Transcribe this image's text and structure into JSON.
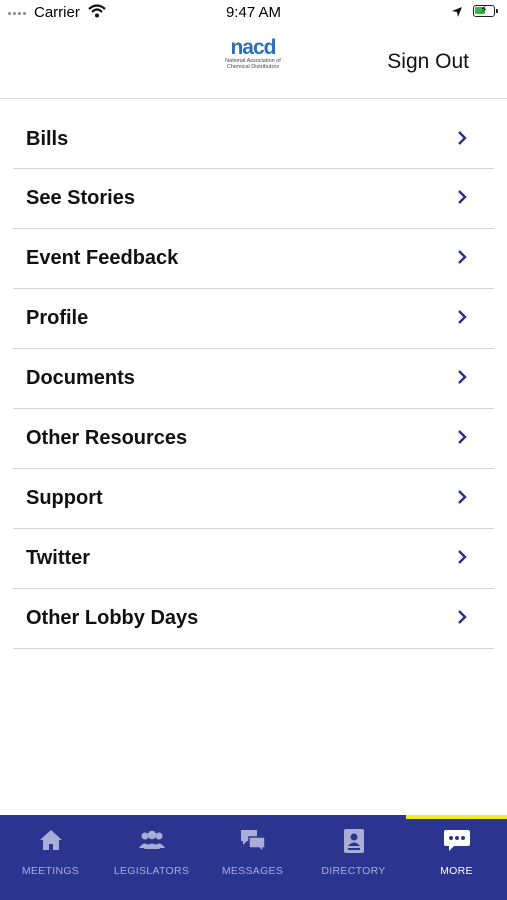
{
  "status": {
    "carrier": "Carrier",
    "time": "9:47 AM"
  },
  "header": {
    "logo_text": "nacd",
    "logo_subtitle": "National Association of Chemical Distributors",
    "sign_out": "Sign Out"
  },
  "menu": {
    "items": [
      {
        "label": "Bills"
      },
      {
        "label": "See Stories"
      },
      {
        "label": "Event Feedback"
      },
      {
        "label": "Profile"
      },
      {
        "label": "Documents"
      },
      {
        "label": "Other Resources"
      },
      {
        "label": "Support"
      },
      {
        "label": "Twitter"
      },
      {
        "label": "Other Lobby Days"
      }
    ]
  },
  "tabs": {
    "items": [
      {
        "label": "MEETINGS",
        "icon": "home-icon"
      },
      {
        "label": "LEGISLATORS",
        "icon": "group-icon"
      },
      {
        "label": "MESSAGES",
        "icon": "chat-bubbles-icon"
      },
      {
        "label": "DIRECTORY",
        "icon": "contact-card-icon"
      },
      {
        "label": "MORE",
        "icon": "more-dots-icon"
      }
    ],
    "active": "MORE"
  },
  "colors": {
    "brand_navy": "#2b3590",
    "indicator_yellow": "#f2ee1a",
    "chevron": "#2a2f8f"
  }
}
